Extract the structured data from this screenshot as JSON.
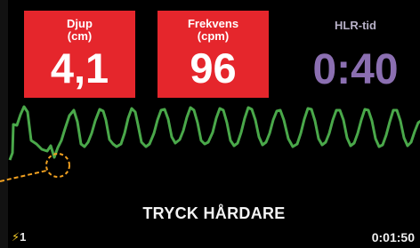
{
  "metrics": {
    "depth": {
      "label_line1": "Djup",
      "label_line2": "(cm)",
      "value": "4,1",
      "color": "#e5262c"
    },
    "rate": {
      "label_line1": "Frekvens",
      "label_line2": "(cpm)",
      "value": "96",
      "color": "#e5262c"
    },
    "cpr_time": {
      "label": "HLR-tid",
      "value": "0:40",
      "color": "#8b6fb1"
    }
  },
  "waveform": {
    "color": "#4aa84a",
    "icon": "compression-waveform"
  },
  "prompt": "TRYCK HÅRDARE",
  "status": {
    "shock_icon": "lightning-icon",
    "shock_count": "1",
    "elapsed": "0:01:50"
  },
  "callout_color": "#f0a020"
}
